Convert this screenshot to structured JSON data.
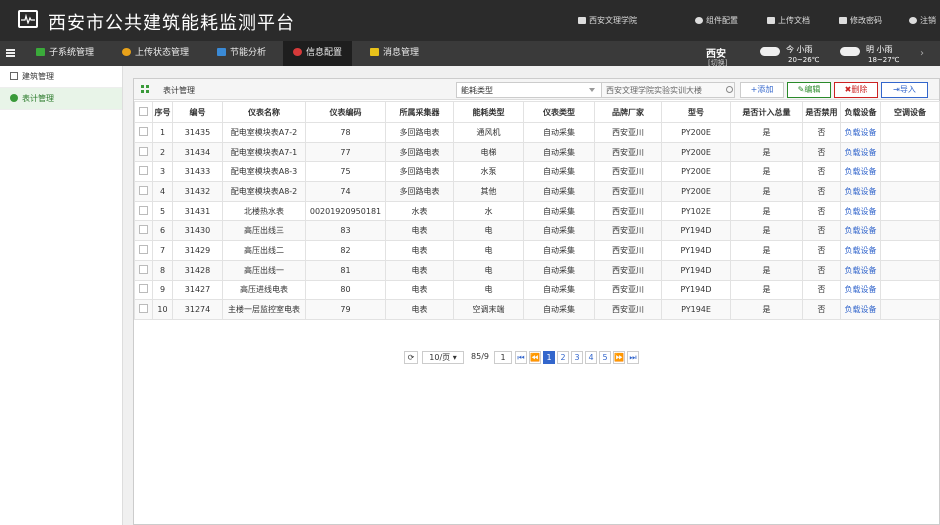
{
  "app": {
    "title": "西安市公共建筑能耗监测平台"
  },
  "toplinks": [
    {
      "label": "西安文理学院",
      "name": "school-link"
    },
    {
      "label": "组件配置",
      "name": "component-config-link"
    },
    {
      "label": "上传文档",
      "name": "upload-doc-link"
    },
    {
      "label": "修改密码",
      "name": "change-password-link"
    },
    {
      "label": "注销",
      "name": "logout-link"
    }
  ],
  "nav": [
    {
      "label": "子系统管理"
    },
    {
      "label": "上传状态管理"
    },
    {
      "label": "节能分析"
    },
    {
      "label": "信息配置"
    },
    {
      "label": "消息管理"
    }
  ],
  "city": {
    "name": "西安",
    "switch": "[切换]"
  },
  "weather": [
    {
      "day": "今 小雨",
      "temp": "20~26℃"
    },
    {
      "day": "明 小雨",
      "temp": "18~27℃"
    }
  ],
  "sidebar": {
    "items": [
      {
        "label": "建筑管理"
      },
      {
        "label": "表计管理"
      }
    ]
  },
  "panel": {
    "title": "表计管理",
    "type_select": "能耗类型",
    "search_value": "西安文理学院实验实训大楼",
    "buttons": {
      "add": "+添加",
      "edit": "编辑",
      "delete": "删除",
      "import": "导入"
    }
  },
  "table": {
    "headers": [
      "序号",
      "编号",
      "仪表名称",
      "仪表编码",
      "所属采集器",
      "能耗类型",
      "仪表类型",
      "品牌厂家",
      "型号",
      "是否计入总量",
      "是否禁用",
      "负载设备",
      "空调设备"
    ],
    "rows": [
      [
        "1",
        "31435",
        "配电室模块表A7-2",
        "78",
        "多回路电表",
        "通风机",
        "自动采集",
        "西安亚川",
        "PY200E",
        "是",
        "否",
        "负载设备",
        ""
      ],
      [
        "2",
        "31434",
        "配电室模块表A7-1",
        "77",
        "多回路电表",
        "电梯",
        "自动采集",
        "西安亚川",
        "PY200E",
        "是",
        "否",
        "负载设备",
        ""
      ],
      [
        "3",
        "31433",
        "配电室模块表A8-3",
        "75",
        "多回路电表",
        "水泵",
        "自动采集",
        "西安亚川",
        "PY200E",
        "是",
        "否",
        "负载设备",
        ""
      ],
      [
        "4",
        "31432",
        "配电室模块表A8-2",
        "74",
        "多回路电表",
        "其他",
        "自动采集",
        "西安亚川",
        "PY200E",
        "是",
        "否",
        "负载设备",
        ""
      ],
      [
        "5",
        "31431",
        "北楼热水表",
        "00201920950181",
        "水表",
        "水",
        "自动采集",
        "西安亚川",
        "PY102E",
        "是",
        "否",
        "负载设备",
        ""
      ],
      [
        "6",
        "31430",
        "高压出线三",
        "83",
        "电表",
        "电",
        "自动采集",
        "西安亚川",
        "PY194D",
        "是",
        "否",
        "负载设备",
        ""
      ],
      [
        "7",
        "31429",
        "高压出线二",
        "82",
        "电表",
        "电",
        "自动采集",
        "西安亚川",
        "PY194D",
        "是",
        "否",
        "负载设备",
        ""
      ],
      [
        "8",
        "31428",
        "高压出线一",
        "81",
        "电表",
        "电",
        "自动采集",
        "西安亚川",
        "PY194D",
        "是",
        "否",
        "负载设备",
        ""
      ],
      [
        "9",
        "31427",
        "高压进线电表",
        "80",
        "电表",
        "电",
        "自动采集",
        "西安亚川",
        "PY194D",
        "是",
        "否",
        "负载设备",
        ""
      ],
      [
        "10",
        "31274",
        "主楼一层监控室电表",
        "79",
        "电表",
        "空调末端",
        "自动采集",
        "西安亚川",
        "PY194E",
        "是",
        "否",
        "负载设备",
        ""
      ]
    ]
  },
  "pager": {
    "per_page": "10/页",
    "total": "85/9",
    "page_input": "1",
    "pages": [
      "1",
      "2",
      "3",
      "4",
      "5"
    ]
  },
  "colors": {
    "topbar": "#2b2b2b",
    "accent_green": "#3a9a3a",
    "link_blue": "#3366cc",
    "delete_red": "#cc2222"
  }
}
